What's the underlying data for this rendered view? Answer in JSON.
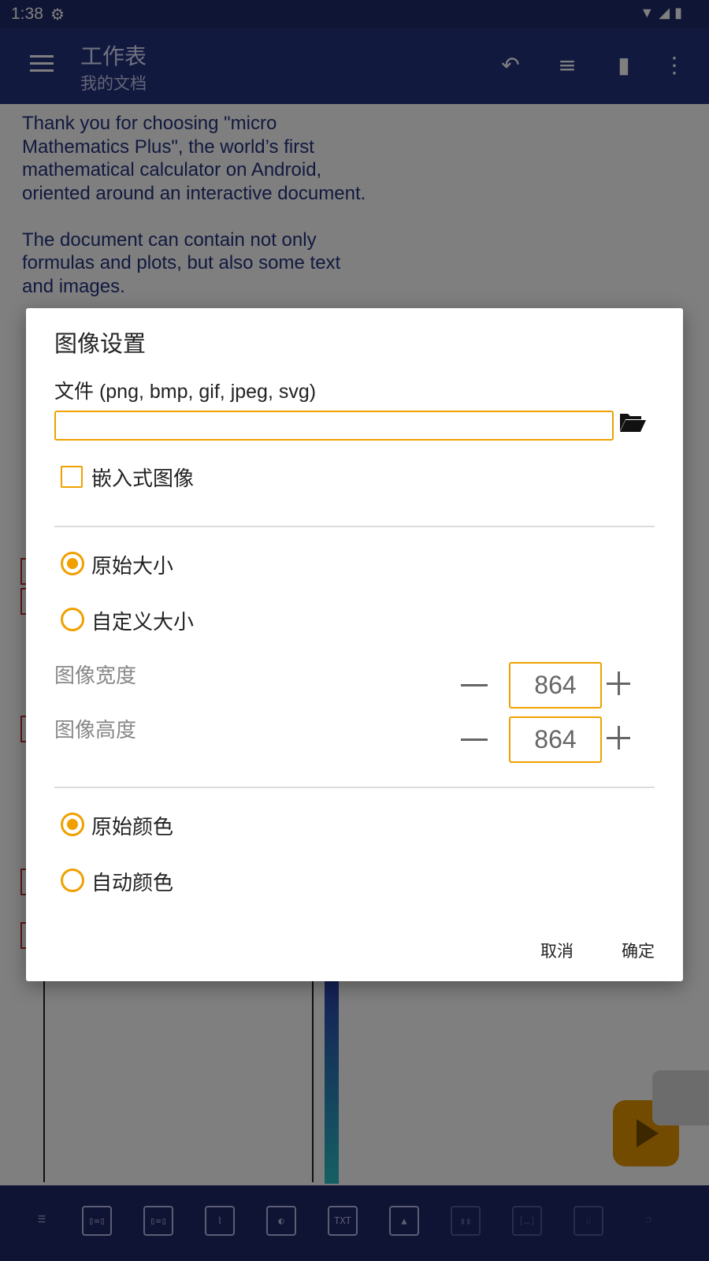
{
  "status_bar": {
    "time": "1:38"
  },
  "app_bar": {
    "title": "工作表",
    "subtitle": "我的文档"
  },
  "document": {
    "paragraphs": [
      "Thank you for choosing \"micro Mathematics Plus\", the world’s first mathematical calculator on Android, oriented around an interactive document.",
      "The document can contain not only formulas and plots, but also some text and images."
    ]
  },
  "dialog": {
    "title": "图像设置",
    "file_label": "文件 (png, bmp, gif, jpeg, svg)",
    "file_value": "",
    "embed_label": "嵌入式图像",
    "size_options": [
      {
        "label": "原始大小",
        "checked": true
      },
      {
        "label": "自定义大小",
        "checked": false
      }
    ],
    "width_label": "图像宽度",
    "width_value": "864",
    "height_label": "图像高度",
    "height_value": "864",
    "color_options": [
      {
        "label": "原始颜色",
        "checked": true
      },
      {
        "label": "自动颜色",
        "checked": false
      }
    ],
    "cancel_label": "取消",
    "ok_label": "确定"
  },
  "bottom_toolbar": {
    "txt_label": "TXT"
  },
  "colors": {
    "app_bar": "#25327e",
    "status_bar": "#1f2a6b",
    "accent": "#f0a000",
    "bottom_bar": "#1e2769"
  },
  "icons": [
    "gear-icon",
    "wifi-icon",
    "signal-icon",
    "battery-icon",
    "menu-icon",
    "undo-icon",
    "add-list-icon",
    "delete-icon",
    "more-icon",
    "folder-open-icon",
    "play-icon"
  ]
}
